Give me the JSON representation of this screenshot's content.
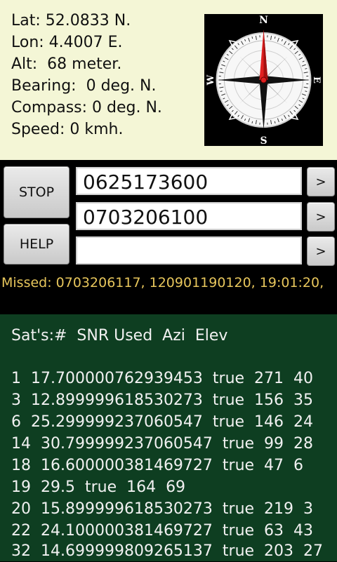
{
  "location": {
    "lat": "Lat: 52.0833 N.",
    "lon": "Lon: 4.4007 E.",
    "alt": "Alt:  68 meter.",
    "bearing": "Bearing:  0 deg. N.",
    "compass": "Compass: 0 deg. N.",
    "speed": "Speed: 0 kmh."
  },
  "compass_rose": {
    "n": "N",
    "e": "E",
    "s": "S",
    "w": "W",
    "heading_deg": 0,
    "needle_color": "#e02020"
  },
  "controls": {
    "stop_label": "STOP",
    "help_label": "HELP",
    "field1_value": "0625173600",
    "field2_value": "0703206100",
    "field3_value": "",
    "arrow_label": ">"
  },
  "missed": {
    "text": "Missed: 0703206117, 120901190120, 19:01:20,"
  },
  "satellites": {
    "header": "Sat's:#  SNR Used  Azi  Elev",
    "rows": [
      "1  17.700000762939453  true  271  40",
      "3  12.899999618530273  true  156  35",
      "6  25.299999237060547  true  146  24",
      "14  30.799999237060547  true  99  28",
      "18  16.600000381469727  true  47  6",
      "19  29.5  true  164  69",
      "20  15.899999618530273  true  219  3",
      "22  24.100000381469727  true  63  43",
      "32  14.699999809265137  true  203  27"
    ]
  },
  "colors": {
    "top_background": "#f4f6d6",
    "missed_text": "#e7c65c",
    "sat_background": "#0e3e21"
  }
}
